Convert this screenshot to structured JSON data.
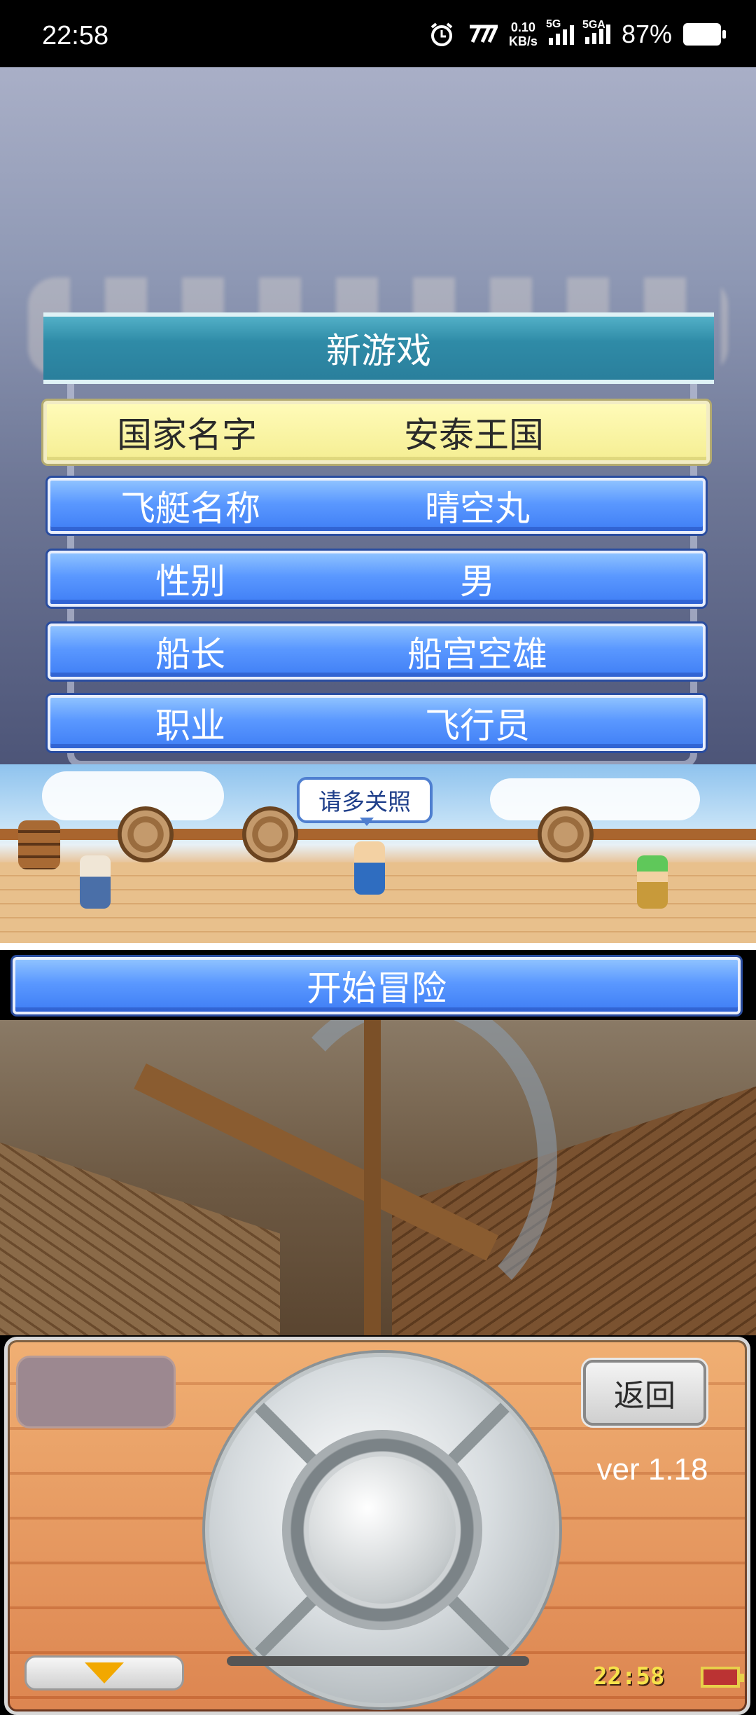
{
  "status_bar": {
    "time": "22:58",
    "net_speed_value": "0.10",
    "net_speed_unit": "KB/s",
    "signal1_label": "5G",
    "signal2_label": "5GA",
    "battery_percent": "87%"
  },
  "new_game": {
    "title": "新游戏",
    "rows": [
      {
        "label": "国家名字",
        "value": "安泰王国"
      },
      {
        "label": "飞艇名称",
        "value": "晴空丸"
      },
      {
        "label": "性别",
        "value": "男"
      },
      {
        "label": "船长",
        "value": "船宫空雄"
      },
      {
        "label": "职业",
        "value": "飞行员"
      }
    ]
  },
  "scene": {
    "speech_bubble": "请多关照"
  },
  "start_button": "开始冒险",
  "controller": {
    "back_label": "返回",
    "version": "ver 1.18",
    "clock": "22:58"
  }
}
